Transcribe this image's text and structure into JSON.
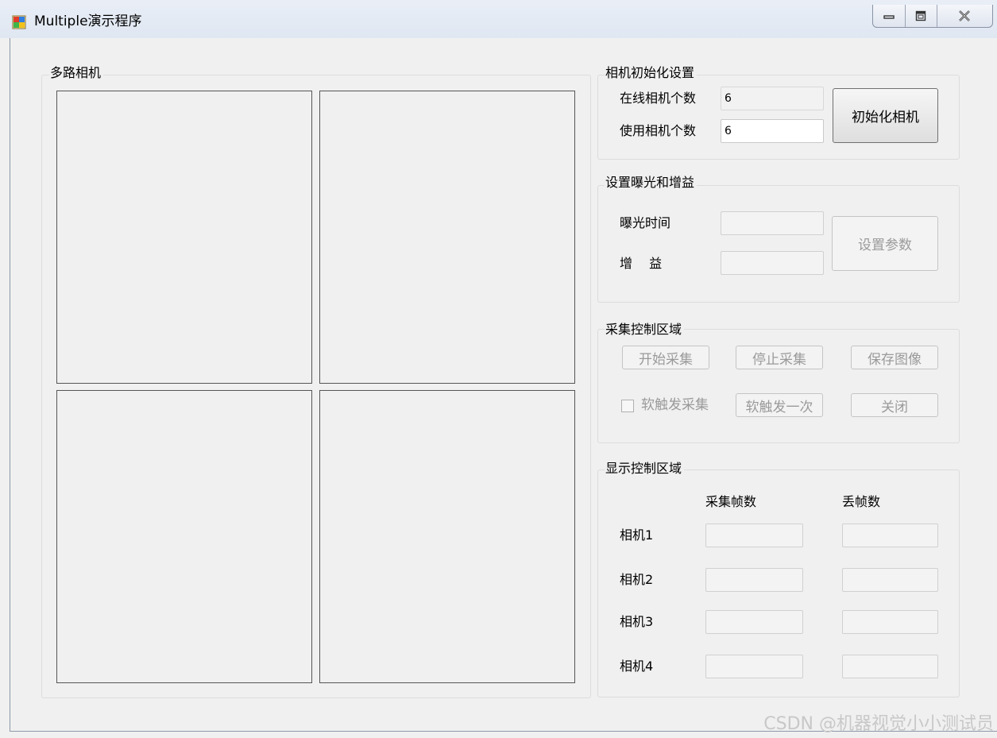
{
  "window": {
    "title": "Multiple演示程序",
    "icon": "app-window-icon",
    "controls": [
      "minimize-icon",
      "maximize-icon",
      "close-icon"
    ]
  },
  "camera_panel": {
    "label": "多路相机",
    "views": [
      "camera-view-1",
      "camera-view-2",
      "camera-view-3",
      "camera-view-4"
    ]
  },
  "init_group": {
    "label": "相机初始化设置",
    "online_label": "在线相机个数",
    "online_value": "6",
    "use_label": "使用相机个数",
    "use_value": "6",
    "init_button": "初始化相机"
  },
  "exposure_group": {
    "label": "设置曝光和增益",
    "exposure_label": "曝光时间",
    "exposure_value": "",
    "gain_label": "增　 益",
    "gain_value": "",
    "set_button": "设置参数"
  },
  "capture_group": {
    "label": "采集控制区域",
    "start_button": "开始采集",
    "stop_button": "停止采集",
    "save_button": "保存图像",
    "soft_trigger_checkbox": "软触发采集",
    "soft_trigger_once_button": "软触发一次",
    "close_button": "关闭"
  },
  "display_group": {
    "label": "显示控制区域",
    "col_frames": "采集帧数",
    "col_lost": "丢帧数",
    "rows": [
      {
        "label": "相机1",
        "frames": "",
        "lost": ""
      },
      {
        "label": "相机2",
        "frames": "",
        "lost": ""
      },
      {
        "label": "相机3",
        "frames": "",
        "lost": ""
      },
      {
        "label": "相机4",
        "frames": "",
        "lost": ""
      }
    ]
  },
  "watermark": "CSDN @机器视觉小小测试员"
}
